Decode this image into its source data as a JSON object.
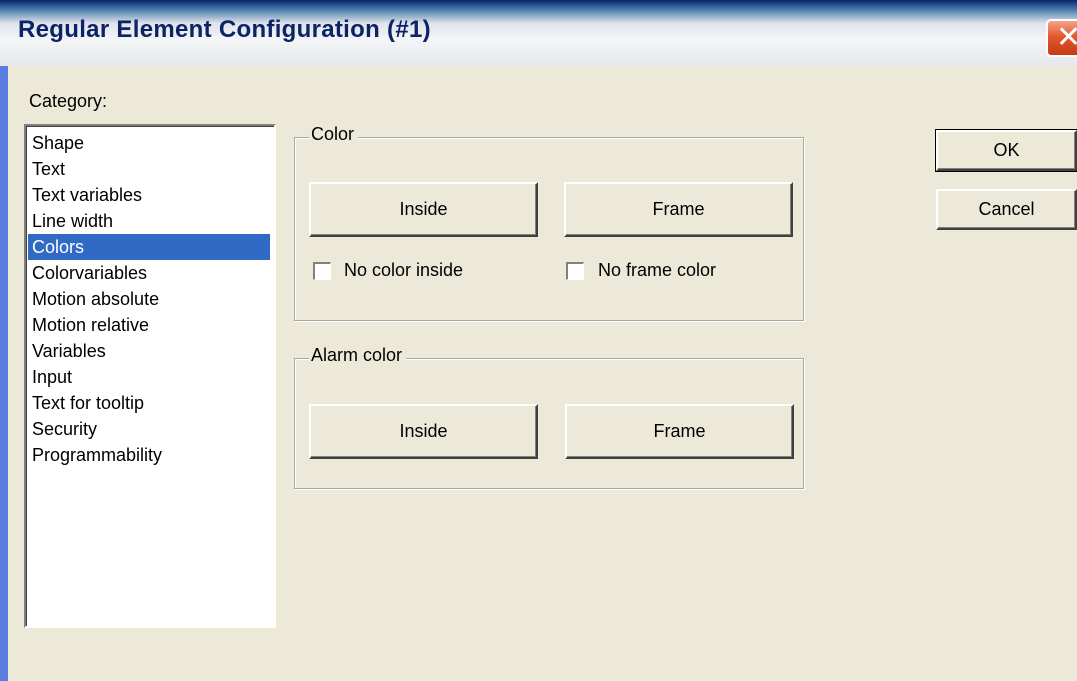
{
  "window": {
    "title": "Regular Element Configuration (#1)",
    "close_glyph": "✕"
  },
  "category": {
    "label": "Category:",
    "items": [
      "Shape",
      "Text",
      "Text variables",
      "Line width",
      "Colors",
      "Colorvariables",
      "Motion absolute",
      "Motion relative",
      "Variables",
      "Input",
      "Text for tooltip",
      "Security",
      "Programmability"
    ],
    "selected": "Colors"
  },
  "color_group": {
    "title": "Color",
    "inside_label": "Inside",
    "frame_label": "Frame",
    "no_color_inside_label": "No color inside",
    "no_frame_color_label": "No frame color",
    "no_color_inside_checked": false,
    "no_frame_color_checked": false
  },
  "alarm_group": {
    "title": "Alarm color",
    "inside_label": "Inside",
    "frame_label": "Frame"
  },
  "actions": {
    "ok_label": "OK",
    "cancel_label": "Cancel"
  },
  "colors": {
    "selection": "#316ac5",
    "dialog_bg": "#ece9d8",
    "close_button": "#e05a2c"
  },
  "icons": {
    "close": "close-icon"
  }
}
